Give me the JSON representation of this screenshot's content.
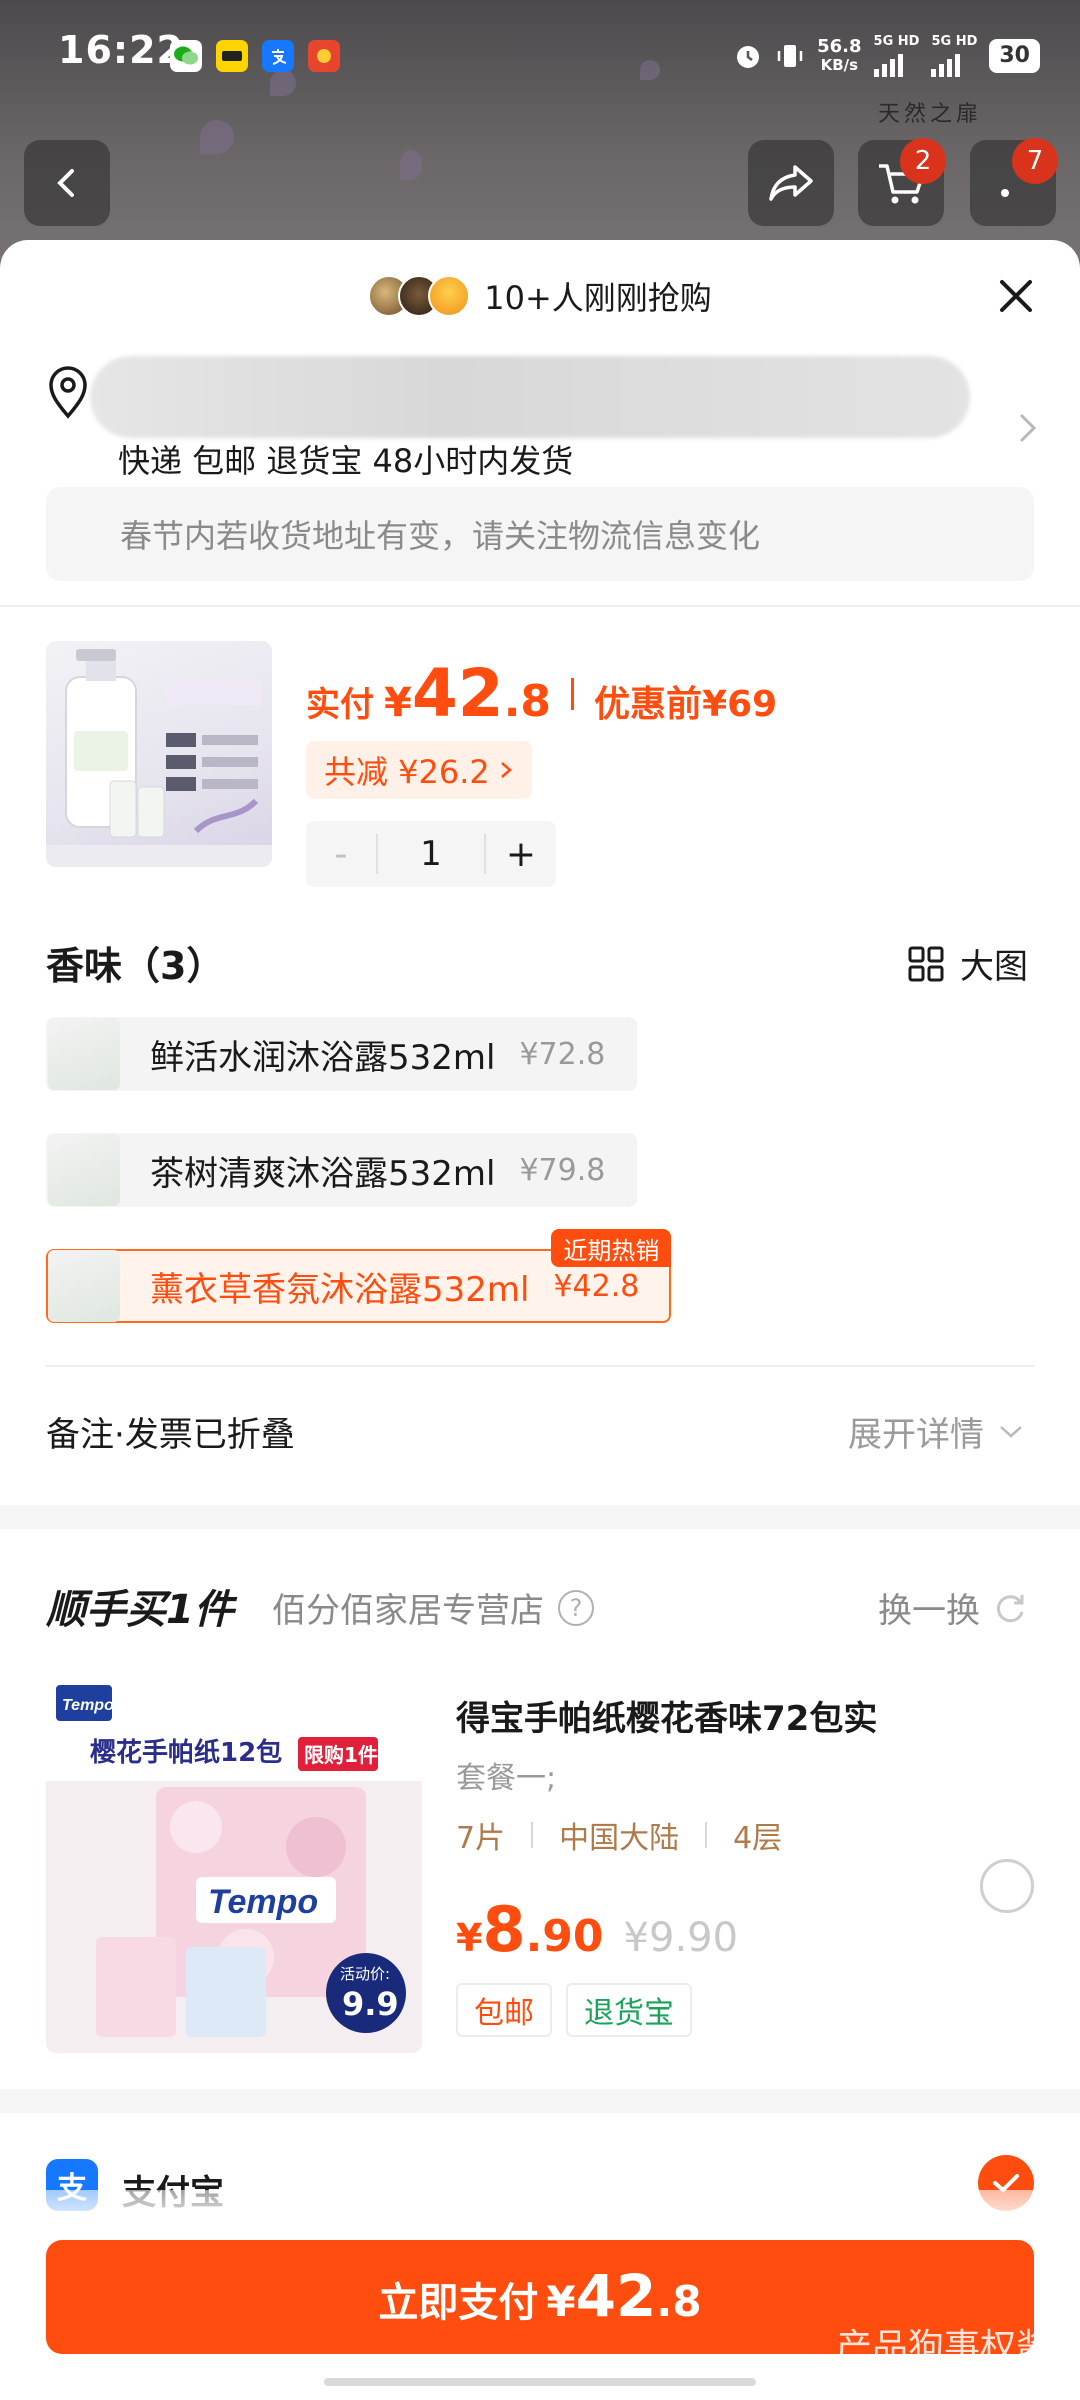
{
  "status_bar": {
    "time": "16:22",
    "net_speed": "56.8",
    "net_unit": "KB/s",
    "sig1": "5G HD",
    "sig2": "5G HD",
    "battery": "30"
  },
  "background": {
    "brand": "天然之扉"
  },
  "nav": {
    "cart_badge": "2",
    "more_badge": "7"
  },
  "header": {
    "buyers_text": "10+人刚刚抢购"
  },
  "address": {
    "shipping": "快递 包邮 退货宝 48小时内发货",
    "notice": "春节内若收货地址有变，请关注物流信息变化"
  },
  "product": {
    "price_label": "实付",
    "currency": "¥",
    "price_int": "42",
    "price_dec": ".8",
    "before_label": "优惠前",
    "before_price": "¥69",
    "saving": "共减 ¥26.2",
    "quantity": "1",
    "minus": "-",
    "plus": "+"
  },
  "variants": {
    "title": "香味（3）",
    "view_label": "大图",
    "options": [
      {
        "name": "鲜活水润沐浴露532ml",
        "price": "¥72.8",
        "selected": false
      },
      {
        "name": "茶树清爽沐浴露532ml",
        "price": "¥79.8",
        "selected": false
      },
      {
        "name": "薰衣草香氛沐浴露532ml",
        "price": "¥42.8",
        "selected": true,
        "tag": "近期热销"
      }
    ]
  },
  "remark": {
    "label": "备注·发票已折叠",
    "expand": "展开详情"
  },
  "addon": {
    "title": "顺手买1件",
    "store": "佰分佰家居专营店",
    "swap": "换一换",
    "name": "得宝手帕纸樱花香味72包实",
    "package": "套餐一;",
    "attrs": [
      "7片",
      "中国大陆",
      "4层"
    ],
    "currency": "¥",
    "price_int": "8",
    "price_dec": ".90",
    "original": "¥9.90",
    "tags": [
      "包邮",
      "退货宝"
    ],
    "img_title": "樱花手帕纸12包",
    "img_limit": "限购1件",
    "img_brand": "Tempo",
    "img_promo_label": "活动价:",
    "img_promo_price": "9.9"
  },
  "payment": {
    "method": "支付宝",
    "icon_char": "支"
  },
  "pay_button": {
    "label": "立即支付",
    "currency": "¥",
    "price_int": "42",
    "price_dec": ".8"
  },
  "watermark": "产品狗事权酱",
  "colors": {
    "accent": "#ff4d0f",
    "alipay": "#1677ff"
  }
}
